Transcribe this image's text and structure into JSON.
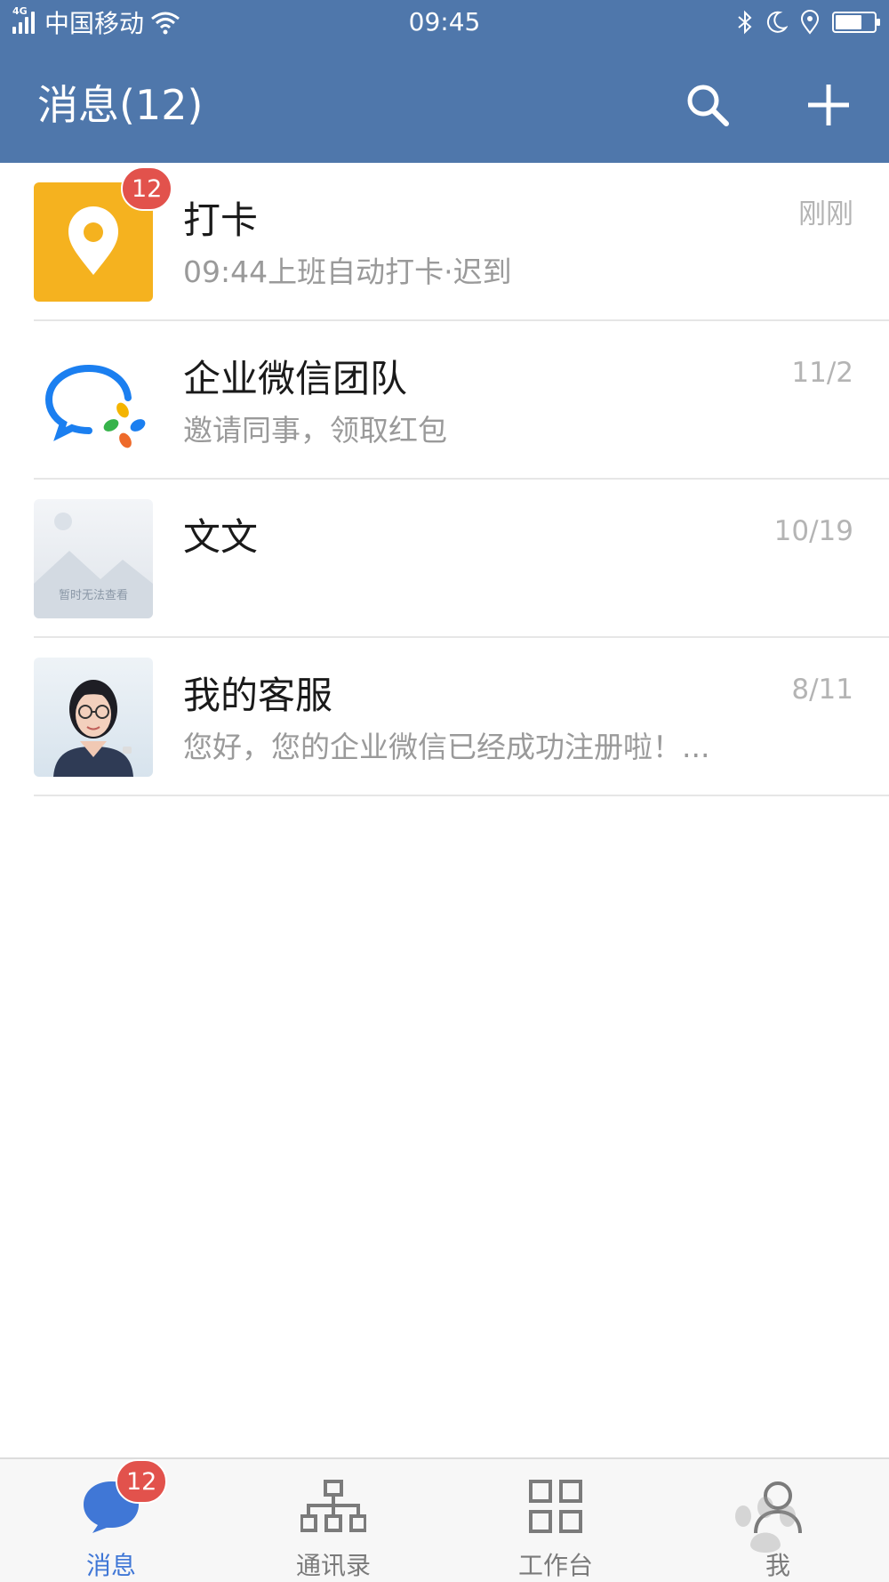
{
  "status_bar": {
    "network": "4G",
    "carrier": "中国移动",
    "time": "09:45",
    "battery_level": 0.7
  },
  "header": {
    "title": "消息(12)",
    "icons": [
      "search-icon",
      "plus-icon"
    ]
  },
  "conversations": [
    {
      "name": "打卡",
      "preview": "09:44上班自动打卡·迟到",
      "time": "刚刚",
      "badge": "12",
      "avatar": "location-pin-icon",
      "avatar_color": "#f5b21f"
    },
    {
      "name": "企业微信团队",
      "preview": "邀请同事，领取红包",
      "time": "11/2",
      "avatar": "wecom-logo-icon"
    },
    {
      "name": "文文",
      "preview": "",
      "time": "10/19",
      "avatar": "placeholder-image",
      "avatar_caption": "暂时无法查看"
    },
    {
      "name": "我的客服",
      "preview": "您好，您的企业微信已经成功注册啦！...",
      "time": "8/11",
      "avatar": "user-photo"
    }
  ],
  "tabbar": {
    "active_color": "#4077d6",
    "tabs": [
      {
        "label": "消息",
        "badge": "12",
        "icon": "chat-bubble-icon",
        "active": true
      },
      {
        "label": "通讯录",
        "icon": "org-chart-icon"
      },
      {
        "label": "工作台",
        "icon": "grid-icon"
      },
      {
        "label": "我",
        "icon": "person-icon"
      }
    ]
  }
}
